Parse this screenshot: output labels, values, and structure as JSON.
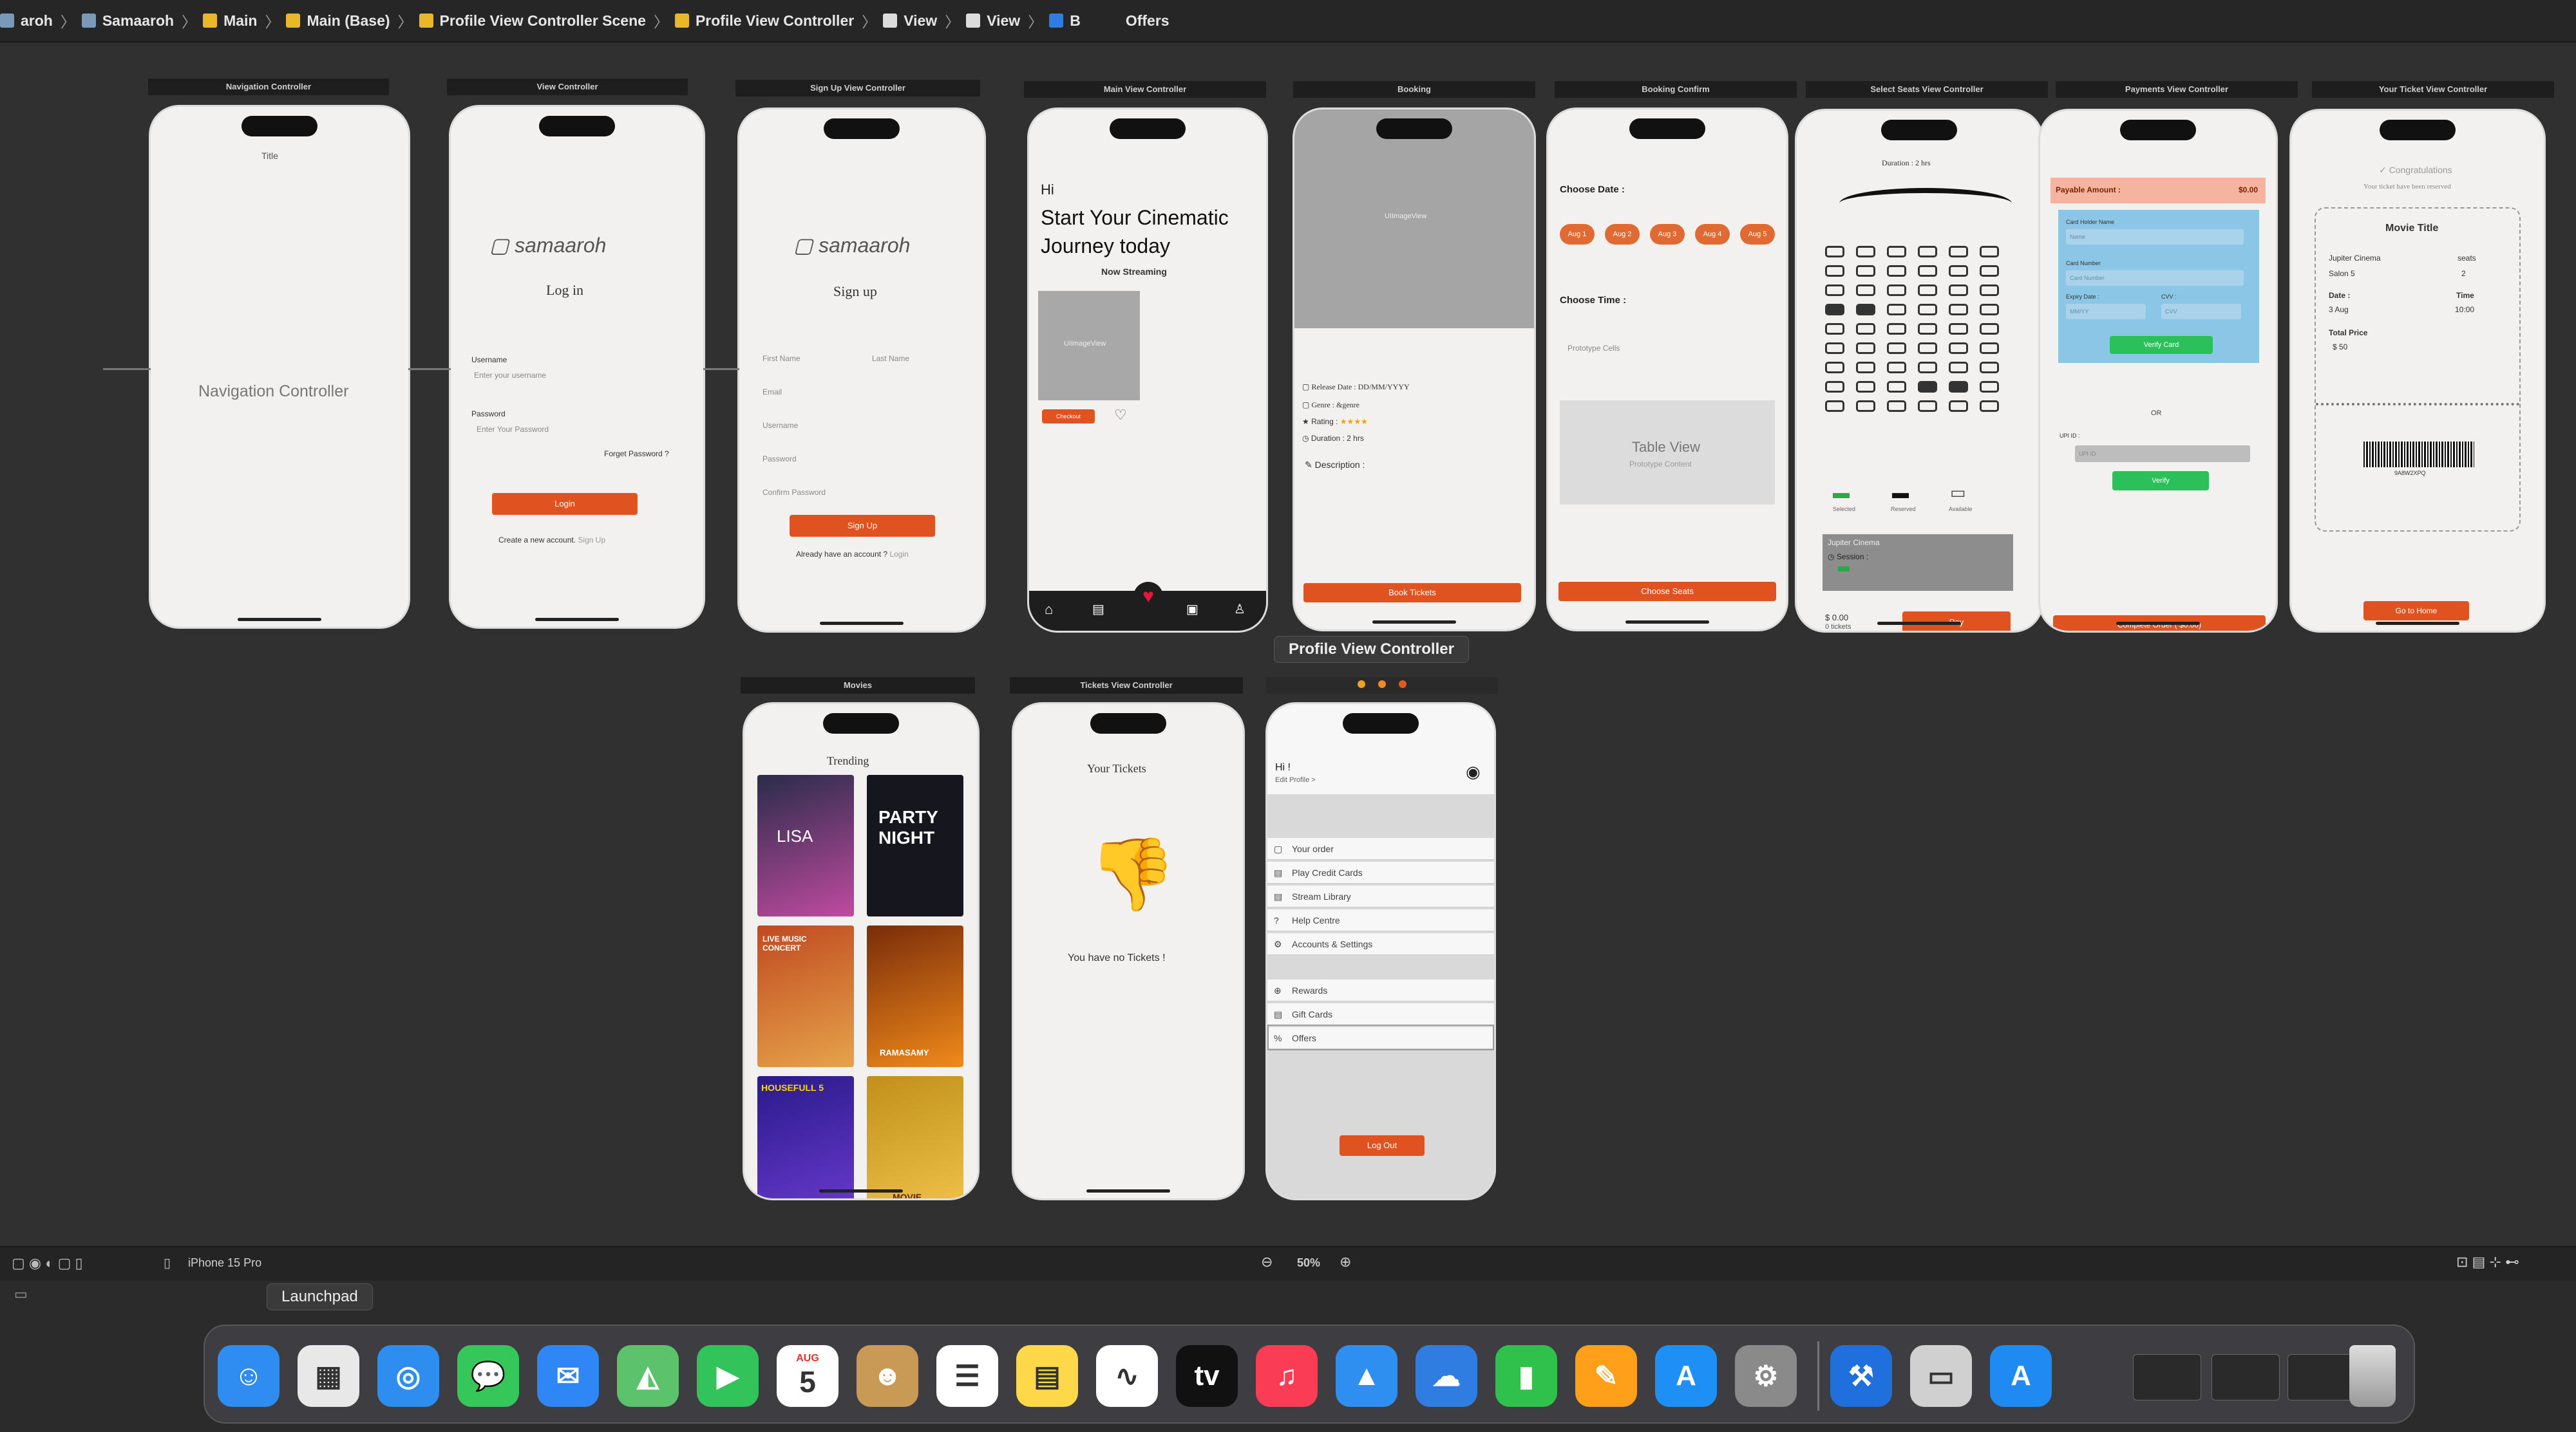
{
  "jump_bar": {
    "items": [
      {
        "label": "aroh",
        "icon": "folder-icon"
      },
      {
        "label": "Samaaroh",
        "icon": "folder-icon"
      },
      {
        "label": "Main",
        "icon": "storyboard-icon"
      },
      {
        "label": "Main (Base)",
        "icon": "storyboard-icon"
      },
      {
        "label": "Profile View Controller Scene",
        "icon": "scene-icon"
      },
      {
        "label": "Profile View Controller",
        "icon": "view-controller-icon"
      },
      {
        "label": "View",
        "icon": "view-icon"
      },
      {
        "label": "View",
        "icon": "view-icon"
      },
      {
        "label": "B",
        "icon": "button-icon"
      },
      {
        "label": "Offers",
        "icon": ""
      }
    ]
  },
  "scenes": {
    "navigation": {
      "bar": "Navigation Controller",
      "title": "Title",
      "center": "Navigation Controller"
    },
    "login": {
      "bar": "View Controller",
      "brand": "samaaroh",
      "heading": "Log in",
      "username_label": "Username",
      "username_placeholder": "Enter your username",
      "password_label": "Password",
      "password_placeholder": "Enter Your Password",
      "forgot": "Forget Password ?",
      "button": "Login",
      "footer": "Create a new account.",
      "footer_link": "Sign Up"
    },
    "signup": {
      "bar": "Sign Up View Controller",
      "brand": "samaaroh",
      "heading": "Sign up",
      "first": "First Name",
      "last": "Last Name",
      "email": "Email",
      "username": "Username",
      "password": "Password",
      "confirm": "Confirm Password",
      "button": "Sign Up",
      "footer": "Already have an account ?",
      "footer_link": "Login"
    },
    "main": {
      "bar": "Main View Controller",
      "hi": "Hi",
      "headline1": "Start Your Cinematic",
      "headline2": "Journey today",
      "now_streaming": "Now Streaming",
      "image_label": "UIImageView",
      "button": "Checkout"
    },
    "booking": {
      "bar": "Booking",
      "image_label": "UIImageView",
      "release": "Release Date : DD/MM/YYYY",
      "genre": "Genre : &genre",
      "rating": "Rating :",
      "stars": "★★★★",
      "duration": "Duration : 2 hrs",
      "description": "Description :",
      "button": "Book Tickets"
    },
    "booking_confirm": {
      "bar": "Booking Confirm",
      "choose_date": "Choose Date :",
      "dates": [
        "Aug 1",
        "Aug 2",
        "Aug 3",
        "Aug 4",
        "Aug 5"
      ],
      "choose_time": "Choose Time :",
      "prototype": "Prototype Cells",
      "table": "Table View",
      "table_sub": "Prototype Content",
      "button": "Choose Seats"
    },
    "seats": {
      "bar": "Select Seats View Controller",
      "duration": "Duration : 2 hrs",
      "legend": [
        "Selected",
        "Reserved",
        "Available"
      ],
      "cinema": "Jupiter Cinema",
      "session": "Session :",
      "price": "$ 0.00",
      "tickets": "0 tickets",
      "button": "Pay"
    },
    "payment": {
      "bar": "Payments View Controller",
      "payable": "Payable Amount :",
      "amount": "$0.00",
      "holder": "Card Holder Name",
      "holder_ph": "Name",
      "number": "Card Number",
      "number_ph": "Card Number",
      "expiry": "Expiry Date :",
      "cvv": "CVV :",
      "expiry_ph": "MM/YY",
      "cvv_ph": "CVV",
      "verify_card": "Verify Card",
      "or": "OR",
      "upi": "UPI ID :",
      "upi_ph": "UPI ID",
      "verify": "Verify",
      "button": "Complete Order ( $0.00)"
    },
    "ticket": {
      "bar": "Your Ticket View Controller",
      "congrats": "Congratulations",
      "reserved": "Your ticket have been reserved",
      "movie": "Movie Title",
      "cinema": "Jupiter Cinema",
      "seats": "seats",
      "salon": "Salon 5",
      "seats_count": "2",
      "date_label": "Date :",
      "time_label": "Time",
      "date": "3 Aug",
      "time": "10:00",
      "total_label": "Total Price",
      "total": "$ 50",
      "code": "9A8W2XPQ",
      "button": "Go to Home"
    },
    "movies": {
      "bar": "Movies",
      "heading": "Trending",
      "posters": [
        "LISA",
        "PARTY NIGHT",
        "LIVE MUSIC CONCERT",
        "RAMASAMY",
        "HOUSEFULL 5",
        "MOVIE"
      ]
    },
    "tickets": {
      "bar": "Tickets View Controller",
      "heading": "Your Tickets",
      "empty": "You have no Tickets !"
    },
    "profile": {
      "bar": "Profile View Controller",
      "hi": "Hi !",
      "edit": "Edit Profile >",
      "items1": [
        "Your order",
        "Play Credit Cards",
        "Stream Library",
        "Help Centre",
        "Accounts & Settings"
      ],
      "items2": [
        "Rewards",
        "Gift Cards",
        "Offers"
      ],
      "button": "Log Out"
    }
  },
  "tooltip_scene": "Profile View Controller",
  "status_bar": {
    "device": "iPhone 15 Pro",
    "zoom": "50%"
  },
  "dock": {
    "tooltip": "Launchpad",
    "apps": [
      {
        "name": "Finder",
        "glyph": "☺",
        "color": "#2f8cf0"
      },
      {
        "name": "Launchpad",
        "glyph": "▦",
        "color": "#e8e8e8"
      },
      {
        "name": "Safari",
        "glyph": "◎",
        "color": "#2d8ef0"
      },
      {
        "name": "Messages",
        "glyph": "💬",
        "color": "#35c759"
      },
      {
        "name": "Mail",
        "glyph": "✉",
        "color": "#2f86f5"
      },
      {
        "name": "Maps",
        "glyph": "◭",
        "color": "#5cc26b"
      },
      {
        "name": "FaceTime",
        "glyph": "▶",
        "color": "#32c45a"
      },
      {
        "name": "Calendar",
        "glyph": "5",
        "color": "#ffffff"
      },
      {
        "name": "Contacts",
        "glyph": "☻",
        "color": "#c99a55"
      },
      {
        "name": "Reminders",
        "glyph": "☰",
        "color": "#ffffff"
      },
      {
        "name": "Notes",
        "glyph": "▤",
        "color": "#ffd84a"
      },
      {
        "name": "Freeform",
        "glyph": "∿",
        "color": "#ffffff"
      },
      {
        "name": "TV",
        "glyph": "tv",
        "color": "#111111"
      },
      {
        "name": "Music",
        "glyph": "♫",
        "color": "#fa3c55"
      },
      {
        "name": "Keynote",
        "glyph": "▲",
        "color": "#2e8ff0"
      },
      {
        "name": "Weather",
        "glyph": "☁",
        "color": "#2f7de0"
      },
      {
        "name": "Numbers",
        "glyph": "▮",
        "color": "#2fc14c"
      },
      {
        "name": "Pages",
        "glyph": "✎",
        "color": "#ff9f1a"
      },
      {
        "name": "App Store",
        "glyph": "A",
        "color": "#1e8ff5"
      },
      {
        "name": "System Settings",
        "glyph": "⚙",
        "color": "#8a8a8a"
      },
      {
        "name": "Xcode",
        "glyph": "⚒",
        "color": "#1f6fdc"
      },
      {
        "name": "Simulator",
        "glyph": "▭",
        "color": "#d0d0d0"
      },
      {
        "name": "Xcode Tools",
        "glyph": "A",
        "color": "#1f8af2"
      }
    ],
    "calendar_month": "AUG",
    "calendar_day": "5"
  }
}
